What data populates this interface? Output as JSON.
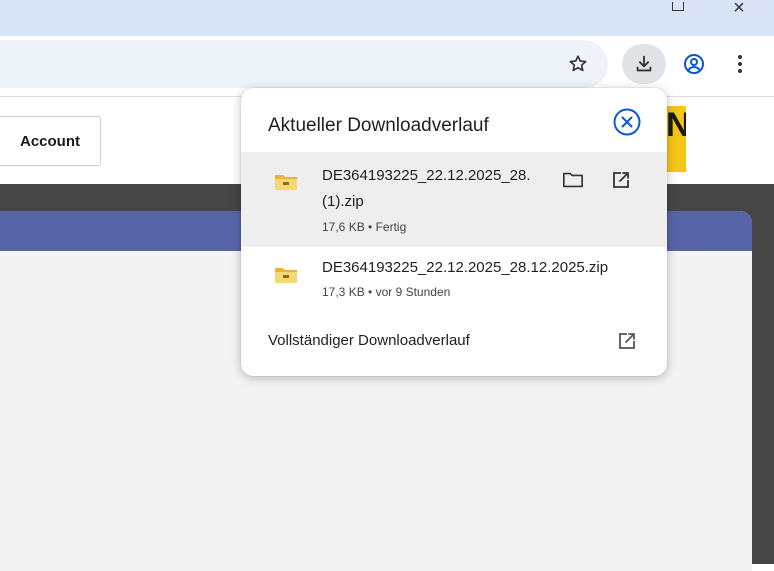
{
  "toolbar": {
    "icons": [
      "bookmark-star-icon",
      "download-icon",
      "profile-icon",
      "kebab-menu-icon"
    ]
  },
  "page": {
    "account_label": "Account",
    "header_color": "#5764a8"
  },
  "downloads": {
    "title": "Aktueller Downloadverlauf",
    "items": [
      {
        "name_line1": "DE364193225_22.12.2025_28.",
        "name_line2": "(1).zip",
        "meta": "17,6 KB • Fertig",
        "icon": "zip-folder-icon"
      },
      {
        "name": "DE364193225_22.12.2025_28.12.2025.zip",
        "meta": "17,3 KB • vor 9 Stunden",
        "icon": "zip-folder-icon"
      }
    ],
    "full_history_label": "Vollständiger Downloadverlauf",
    "accent_color": "#0b57d0"
  }
}
